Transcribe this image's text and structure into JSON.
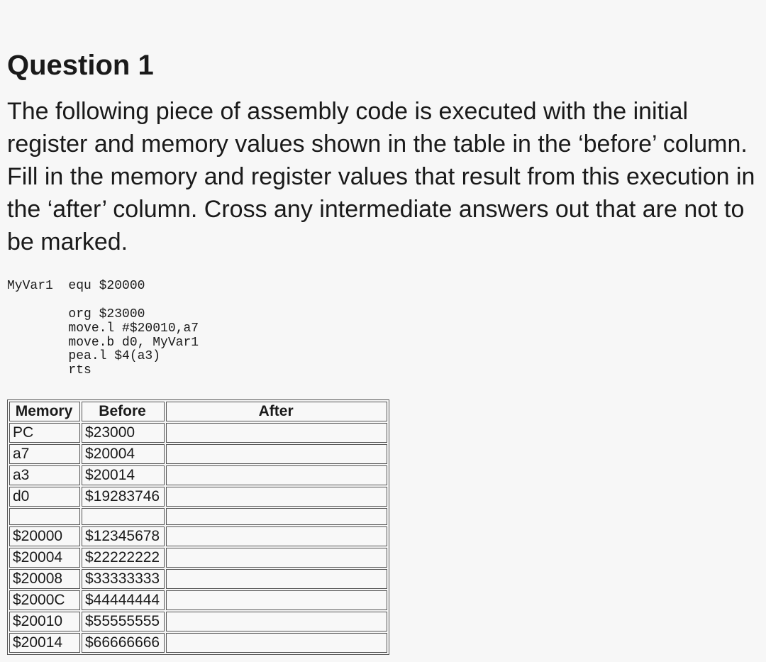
{
  "title": "Question 1",
  "prompt": "The following piece of assembly code is executed with the initial register and memory values shown in the table in the ‘before’ column. Fill in the memory and register values that result from this execution in the ‘after’ column. Cross any intermediate answers out that are not to be marked.",
  "code": "MyVar1  equ $20000\n\n        org $23000\n        move.l #$20010,a7\n        move.b d0, MyVar1\n        pea.l $4(a3)\n        rts",
  "table": {
    "headers": [
      "Memory",
      "Before",
      "After"
    ],
    "rows_top": [
      {
        "mem": "PC",
        "before": "$23000",
        "after": ""
      },
      {
        "mem": "a7",
        "before": "$20004",
        "after": ""
      },
      {
        "mem": "a3",
        "before": "$20014",
        "after": ""
      },
      {
        "mem": "d0",
        "before": "$19283746",
        "after": ""
      }
    ],
    "rows_bottom": [
      {
        "mem": "$20000",
        "before": "$12345678",
        "after": ""
      },
      {
        "mem": "$20004",
        "before": "$22222222",
        "after": ""
      },
      {
        "mem": "$20008",
        "before": "$33333333",
        "after": ""
      },
      {
        "mem": "$2000C",
        "before": "$44444444",
        "after": ""
      },
      {
        "mem": "$20010",
        "before": "$55555555",
        "after": ""
      },
      {
        "mem": "$20014",
        "before": "$66666666",
        "after": ""
      }
    ]
  }
}
